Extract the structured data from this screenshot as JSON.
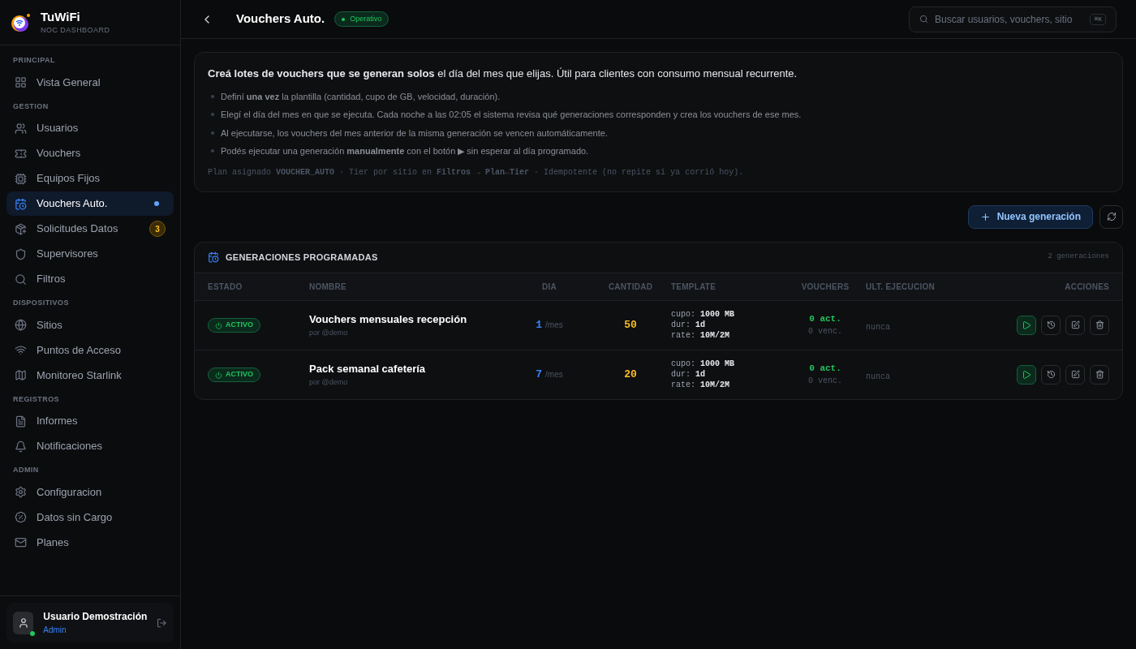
{
  "brand": {
    "name": "TuWiFi",
    "subtitle": "NOC DASHBOARD"
  },
  "sidebar": {
    "sections": [
      {
        "title": "PRINCIPAL",
        "items": [
          {
            "label": "Vista General",
            "selected": false
          }
        ]
      },
      {
        "title": "GESTION",
        "items": [
          {
            "label": "Usuarios",
            "selected": false
          },
          {
            "label": "Vouchers",
            "selected": false
          },
          {
            "label": "Equipos Fijos",
            "selected": false
          },
          {
            "label": "Vouchers Auto.",
            "selected": true
          },
          {
            "label": "Solicitudes Datos",
            "selected": false,
            "badge": "3"
          },
          {
            "label": "Supervisores",
            "selected": false
          },
          {
            "label": "Filtros",
            "selected": false
          }
        ]
      },
      {
        "title": "DISPOSITIVOS",
        "items": [
          {
            "label": "Sitios",
            "selected": false
          },
          {
            "label": "Puntos de Acceso",
            "selected": false
          },
          {
            "label": "Monitoreo Starlink",
            "selected": false
          }
        ]
      },
      {
        "title": "REGISTROS",
        "items": [
          {
            "label": "Informes",
            "selected": false
          },
          {
            "label": "Notificaciones",
            "selected": false
          }
        ]
      },
      {
        "title": "ADMIN",
        "items": [
          {
            "label": "Configuracion",
            "selected": false
          },
          {
            "label": "Datos sin Cargo",
            "selected": false
          },
          {
            "label": "Planes",
            "selected": false
          }
        ]
      }
    ]
  },
  "user": {
    "name": "Usuario Demostración",
    "role": "Admin",
    "online": true
  },
  "header": {
    "title": "Vouchers Auto.",
    "status": "Operativo",
    "search_placeholder": "Buscar usuarios, vouchers, sitio",
    "shortcut": "⌘K"
  },
  "intro": {
    "lead": "**Creá lotes de vouchers que se generan solos** el día del mes que elijas. Útil para clientes con consumo mensual recurrente.",
    "bullets": [
      "Definí **una vez** la plantilla (cantidad, cupo de GB, velocidad, duración).",
      "Elegí el día del mes en que se ejecuta. Cada noche a las 02:05 el sistema revisa qué generaciones corresponden y crea los vouchers de ese mes.",
      "Al ejecutarse, los vouchers del mes anterior de la misma generación se vencen automáticamente.",
      "Podés ejecutar una generación **manualmente** con el botón ▶ sin esperar al día programado."
    ],
    "note": "Plan asignado **VOUCHER_AUTO** · Tier por sitio en **Filtros → Plan↔Tier** · Idempotente (no repite si ya corrió hoy)."
  },
  "new_button": "Nueva generación",
  "table": {
    "title": "GENERACIONES PROGRAMADAS",
    "count": "2 generaciones",
    "columns": [
      "ESTADO",
      "NOMBRE",
      "DIA",
      "CANTIDAD",
      "TEMPLATE",
      "VOUCHERS",
      "ULT. EJECUCION",
      "ACCIONES"
    ],
    "rows": [
      {
        "status": "ACTIVO",
        "active": true,
        "name": "Vouchers mensuales recepción",
        "owner": "por @demo",
        "day": "1",
        "day_unit": "/mes",
        "quantity": "50",
        "template": [
          {
            "key": "cupo:",
            "value": "1000 MB"
          },
          {
            "key": "dur:",
            "value": "1d"
          },
          {
            "key": "rate:",
            "value": "10M/2M"
          }
        ],
        "active_vouchers": "0 act.",
        "expired_vouchers": "0 venc.",
        "last_run": "nunca"
      },
      {
        "status": "ACTIVO",
        "active": true,
        "name": "Pack semanal cafetería",
        "owner": "por @demo",
        "day": "7",
        "day_unit": "/mes",
        "quantity": "20",
        "template": [
          {
            "key": "cupo:",
            "value": "1000 MB"
          },
          {
            "key": "dur:",
            "value": "1d"
          },
          {
            "key": "rate:",
            "value": "10M/2M"
          }
        ],
        "active_vouchers": "0 act.",
        "expired_vouchers": "0 venc.",
        "last_run": "nunca"
      }
    ]
  }
}
